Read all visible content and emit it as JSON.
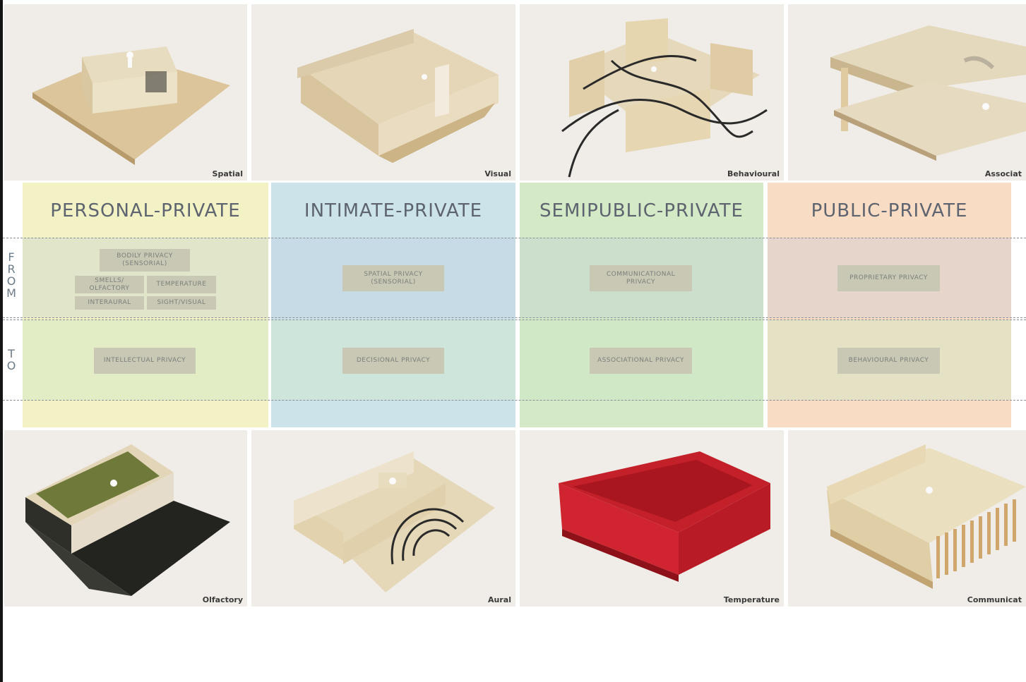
{
  "photos_top": [
    {
      "caption": "Spatial"
    },
    {
      "caption": "Visual"
    },
    {
      "caption": "Behavioural"
    },
    {
      "caption": "Associat"
    }
  ],
  "photos_bottom": [
    {
      "caption": "Olfactory"
    },
    {
      "caption": "Aural"
    },
    {
      "caption": "Temperature"
    },
    {
      "caption": "Communicat"
    }
  ],
  "row_labels": {
    "from": [
      "F",
      "R",
      "O",
      "M"
    ],
    "to": [
      "T",
      "O"
    ]
  },
  "categories": [
    {
      "title": "PERSONAL-PRIVATE",
      "color": "#f2f2c4",
      "from_tags": [
        "BODILY PRIVACY (SENSORIAL)",
        "SMELLS/ OLFACTORY",
        "TEMPERATURE",
        "INTERAURAL",
        "SIGHT/VISUAL"
      ],
      "to_tags": [
        "INTELLECTUAL PRIVACY"
      ]
    },
    {
      "title": "INTIMATE-PRIVATE",
      "color": "#cde3ea",
      "from_tags": [
        "SPATIAL PRIVACY (SENSORIAL)"
      ],
      "to_tags": [
        "DECISIONAL PRIVACY"
      ]
    },
    {
      "title": "SEMIPUBLIC-PRIVATE",
      "color": "#d4e9c6",
      "from_tags": [
        "COMMUNICATIONAL PRIVACY"
      ],
      "to_tags": [
        "ASSOCIATIONAL PRIVACY"
      ]
    },
    {
      "title": "PUBLIC-PRIVATE",
      "color": "#f8dcc4",
      "from_tags": [
        "PROPRIETARY PRIVACY"
      ],
      "to_tags": [
        "BEHAVIOURAL PRIVACY"
      ]
    }
  ],
  "colors": {
    "from_row_tint": "#b7c7db",
    "to_row_tint": "#cfe6c8"
  }
}
